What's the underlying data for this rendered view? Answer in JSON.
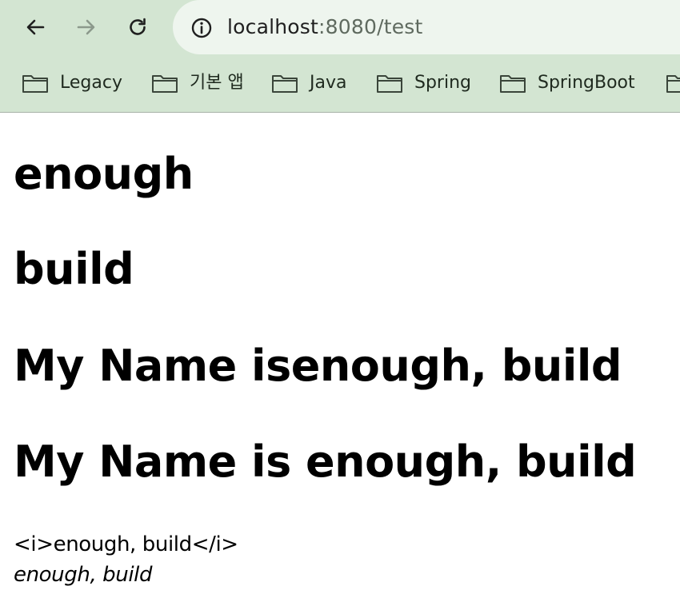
{
  "browser": {
    "url_host": "localhost",
    "url_rest": ":8080/test",
    "bookmarks": [
      {
        "label": "Legacy"
      },
      {
        "label": "기본 앱"
      },
      {
        "label": "Java"
      },
      {
        "label": "Spring"
      },
      {
        "label": "SpringBoot"
      }
    ]
  },
  "page": {
    "heading_1": "enough",
    "heading_2": "build",
    "heading_3": "My Name isenough, build",
    "heading_4": "My Name is enough, build",
    "escaped_text": "<i>enough, build</i>",
    "italic_text": "enough, build"
  }
}
